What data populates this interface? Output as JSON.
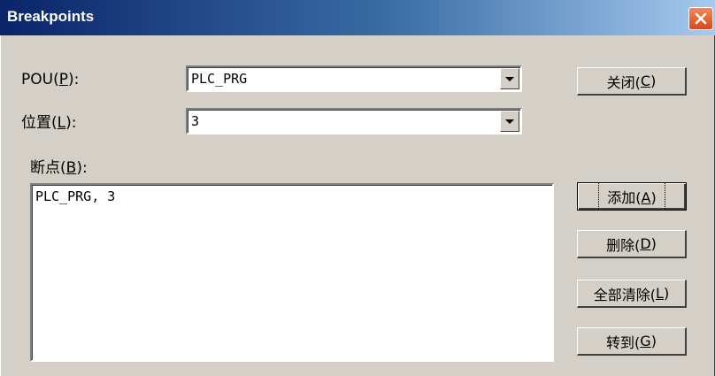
{
  "window": {
    "title": "Breakpoints",
    "close_icon": "close-x-icon"
  },
  "fields": {
    "pou": {
      "label": "POU(",
      "accel": "P",
      "label_end": "):",
      "value": "PLC_PRG"
    },
    "position": {
      "label": "位置(",
      "accel": "L",
      "label_end": "):",
      "value": "3"
    },
    "breakpoints": {
      "label": "断点(",
      "accel": "B",
      "label_end": "):"
    }
  },
  "breakpoint_list": [
    "PLC_PRG, 3"
  ],
  "buttons": {
    "close": {
      "label": "关闭(",
      "accel": "C",
      "end": ")"
    },
    "add": {
      "label": "添加(",
      "accel": "A",
      "end": ")"
    },
    "delete": {
      "label": "删除(",
      "accel": "D",
      "end": ")"
    },
    "clear_all": {
      "label": "全部清除(",
      "accel": "L",
      "end": ")"
    },
    "goto": {
      "label": "转到(",
      "accel": "G",
      "end": ")"
    }
  },
  "colors": {
    "face": "#d4d0c8",
    "title_start": "#0a246a",
    "title_end": "#a6caf0",
    "close_button": "#d9481c"
  }
}
